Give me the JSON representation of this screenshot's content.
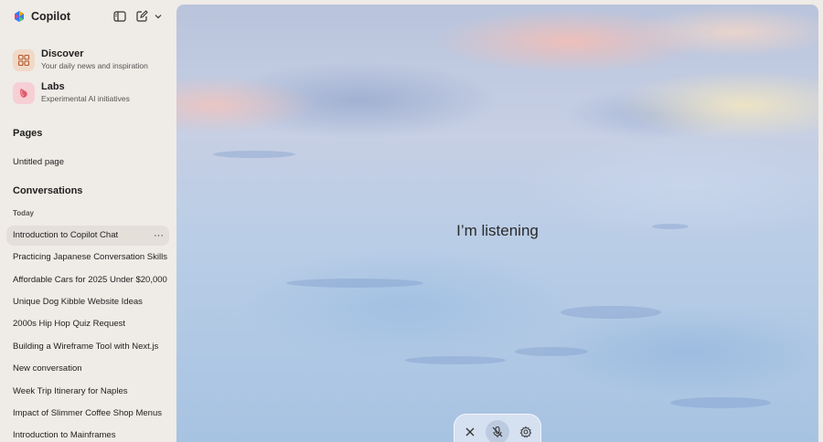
{
  "app": {
    "title": "Copilot",
    "accent_colors": [
      "#f2a900",
      "#e9428a",
      "#2e7cf6",
      "#53c27a"
    ]
  },
  "toolbar": {
    "icons": [
      "sidebar-toggle-icon",
      "new-chat-icon",
      "chevron-down-icon"
    ]
  },
  "features": [
    {
      "title": "Discover",
      "subtitle": "Your daily news and inspiration",
      "icon": "discover-grid-icon"
    },
    {
      "title": "Labs",
      "subtitle": "Experimental AI initiatives",
      "icon": "labs-flask-icon"
    }
  ],
  "pages": {
    "heading": "Pages",
    "items": [
      "Untitled page"
    ]
  },
  "conversations": {
    "heading": "Conversations",
    "group_label": "Today",
    "items": [
      "Introduction to Copilot Chat",
      "Practicing Japanese Conversation Skills",
      "Affordable Cars for 2025 Under $20,000",
      "Unique Dog Kibble Website Ideas",
      "2000s Hip Hop Quiz Request",
      "Building a Wireframe Tool with Next.js",
      "New conversation",
      "Week Trip Itinerary for Naples",
      "Impact of Slimmer Coffee Shop Menus",
      "Introduction to Mainframes"
    ],
    "active_item": "Introduction to Copilot Chat"
  },
  "voice": {
    "status_text": "I’m listening",
    "controls": [
      "close-icon",
      "mic-muted-icon",
      "settings-gear-icon"
    ]
  }
}
